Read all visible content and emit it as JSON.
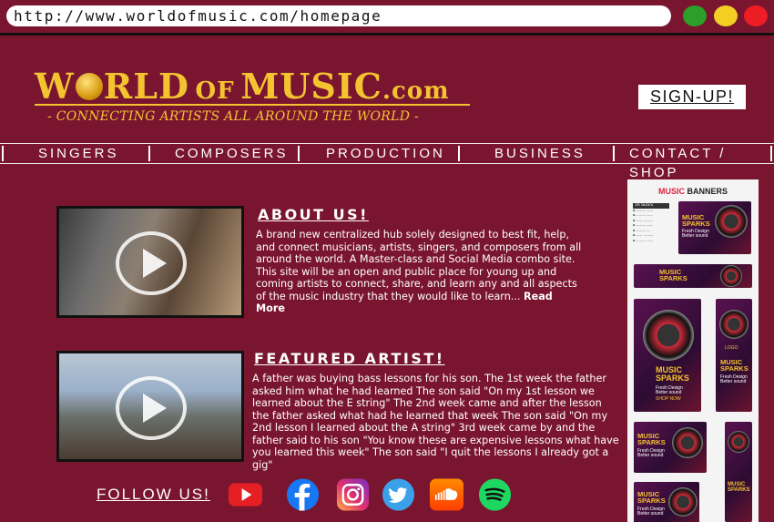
{
  "browser": {
    "url": "http://www.worldofmusic.com/homepage",
    "colors": {
      "green": "#2e9e2b",
      "yellow": "#f2cf22",
      "red": "#ee1d24"
    }
  },
  "header": {
    "logo_part1": "W",
    "logo_part2": "RLD",
    "logo_of": "OF",
    "logo_music": "MUSIC",
    "logo_com": ".com",
    "tagline": "- CONNECTING ARTISTS ALL AROUND THE WORLD -",
    "signup_label": "SIGN-UP!"
  },
  "nav": {
    "items": [
      "SINGERS",
      "COMPOSERS",
      "PRODUCTION",
      "BUSINESS",
      "CONTACT / SHOP"
    ]
  },
  "about": {
    "title": "ABOUT US!",
    "text": "A brand new centralized hub solely designed to best fit, help, and connect musicians, artists, singers, and composers from all around the world. A Master-class and Social Media combo site. This site will be an open and public place for young up and coming artists to connect, share, and learn any and all aspects of the music industry that they would like to learn...",
    "read_more": "Read More"
  },
  "artist": {
    "title": "FEATURED ARTIST!",
    "text": "A father was buying bass lessons for his son. The 1st week the father asked him what he had learned The son said \"On my 1st lesson we learned about the E string\" The 2nd week came and after the lesson the father asked what had he learned that week The son said \"On my 2nd lesson I learned about the A string\" 3rd week came by and the father said to his son \"You know these are expensive lessons what have you learned this week\" The son said \"I quit the lessons I already got a gig\""
  },
  "follow": {
    "label": "FOLLOW US!",
    "socials": [
      "youtube-icon",
      "facebook-icon",
      "instagram-icon",
      "twitter-icon",
      "soundcloud-icon",
      "spotify-icon"
    ]
  },
  "ads": {
    "heading_red": "MUSIC",
    "heading_rest": "BANNERS",
    "sizes_label": "16 SIZES",
    "banner_title_1": "MUSIC",
    "banner_title_2": "SPARKS",
    "banner_sub": "Fresh Design Better sound",
    "shop_label": "SHOP NOW",
    "logo_label": "LOGO"
  }
}
